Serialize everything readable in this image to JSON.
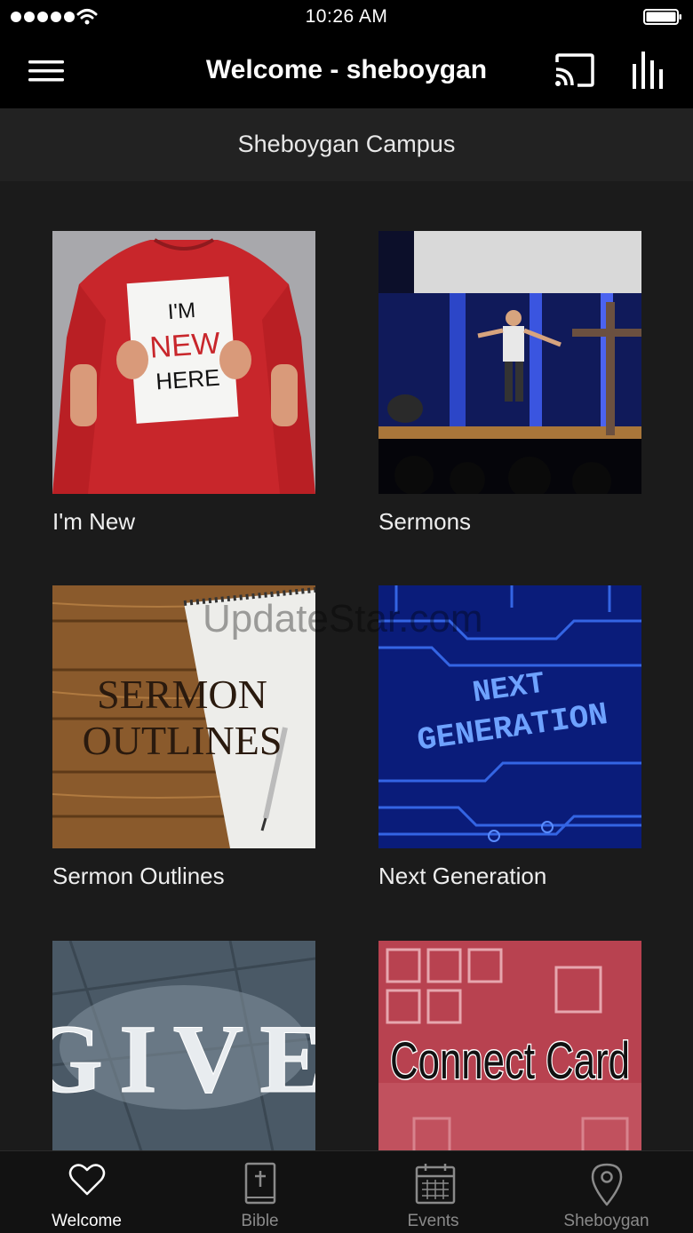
{
  "status_bar": {
    "time": "10:26 AM"
  },
  "nav": {
    "title": "Welcome - sheboygan"
  },
  "campus": {
    "title": "Sheboygan Campus"
  },
  "tiles": [
    {
      "label": "I'm New",
      "image_text": [
        "I'M",
        "NEW",
        "HERE"
      ]
    },
    {
      "label": "Sermons"
    },
    {
      "label": "Sermon Outlines",
      "image_text": [
        "SERMON",
        "OUTLINES"
      ]
    },
    {
      "label": "Next Generation",
      "image_text": [
        "NEXT",
        "GENERATION"
      ]
    },
    {
      "label": "",
      "image_text": [
        "GIVE"
      ]
    },
    {
      "label": "",
      "image_text": [
        "Connect Card"
      ]
    }
  ],
  "watermark": "UpdateStar.com",
  "tabs": [
    {
      "label": "Welcome",
      "icon": "heart-icon",
      "active": true
    },
    {
      "label": "Bible",
      "icon": "bible-icon",
      "active": false
    },
    {
      "label": "Events",
      "icon": "calendar-icon",
      "active": false
    },
    {
      "label": "Sheboygan",
      "icon": "location-pin-icon",
      "active": false
    }
  ],
  "colors": {
    "background": "#1b1b1b",
    "bar": "#000000",
    "campus_bar": "#222222",
    "tab_inactive": "#8a8a8a"
  }
}
